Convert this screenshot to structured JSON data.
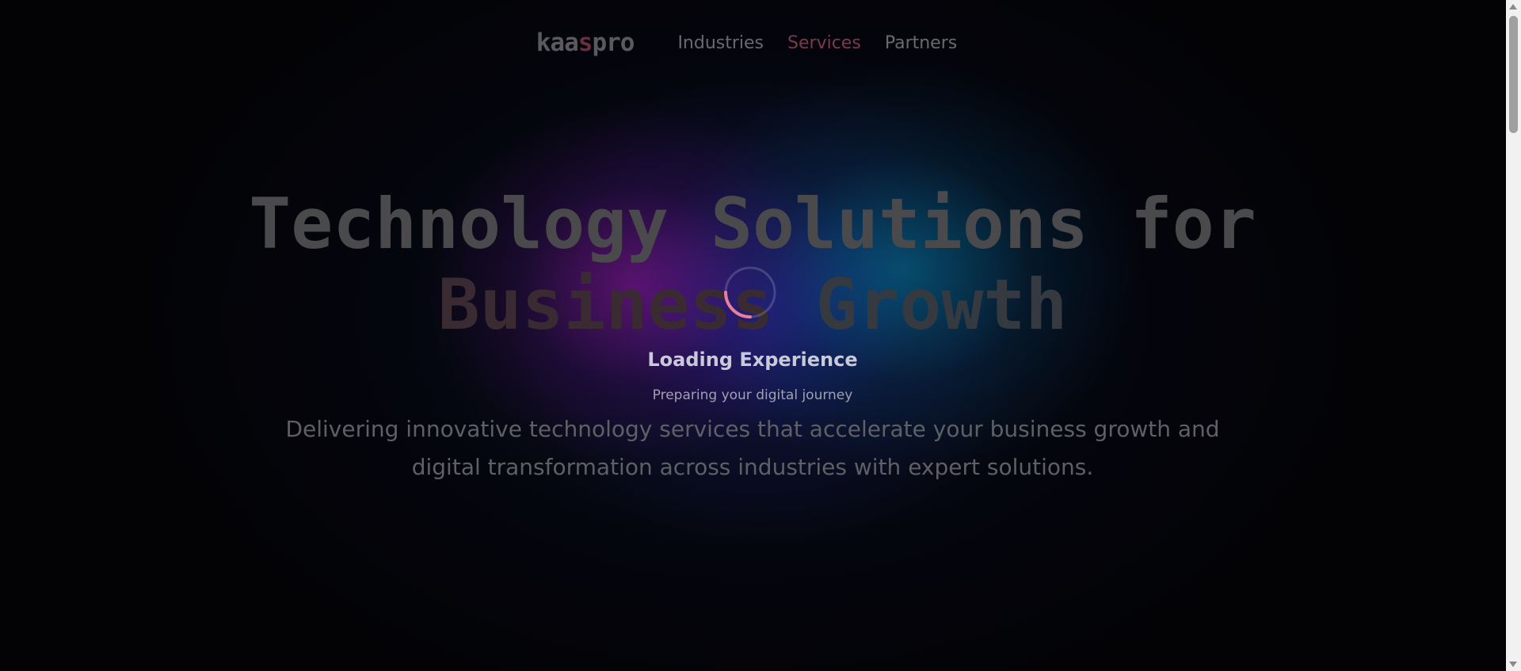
{
  "nav": {
    "logo_prefix": "kaa",
    "logo_accent": "s",
    "logo_suffix": "pro",
    "links": [
      {
        "label": "Industries",
        "active": false
      },
      {
        "label": "Services",
        "active": true
      },
      {
        "label": "Partners",
        "active": false
      }
    ]
  },
  "hero": {
    "title_line1": "Technology Solutions for",
    "title_line2_a": "Business",
    "title_line2_b": "Growth",
    "description_line1": "Delivering innovative technology services that accelerate your business growth and",
    "description_line2": "digital transformation across industries with expert solutions."
  },
  "loader": {
    "title": "Loading Experience",
    "subtitle": "Preparing your digital journey",
    "icon": "loading-spinner-icon"
  },
  "colors": {
    "accent": "#e05a7a",
    "glow_magenta": "#9614a0",
    "glow_blue": "#2828c8",
    "glow_cyan": "#0096be",
    "background": "#030306"
  }
}
